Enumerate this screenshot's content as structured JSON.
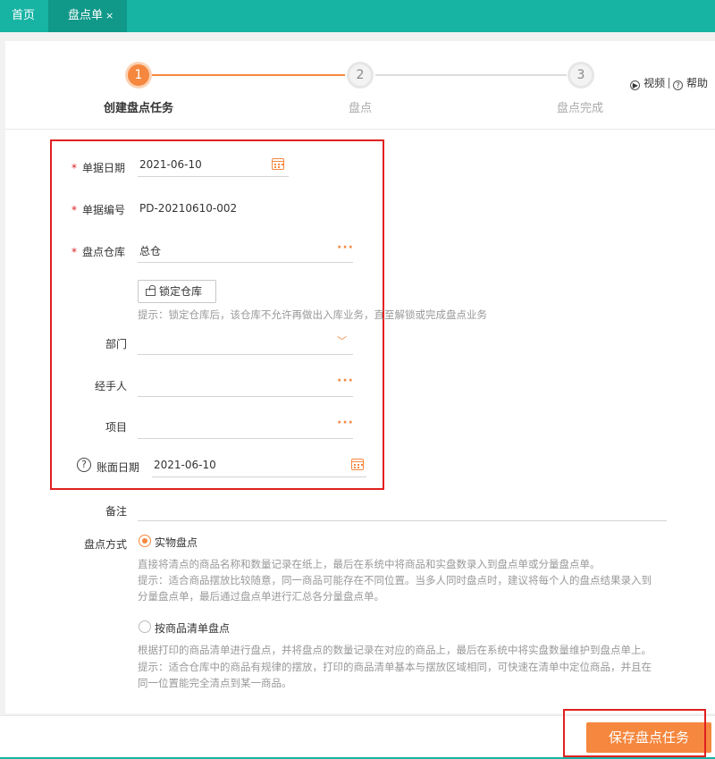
{
  "tabs": {
    "home": "首页",
    "active": "盘点单",
    "close": "×"
  },
  "steps": [
    {
      "number": "1",
      "label": "创建盘点任务"
    },
    {
      "number": "2",
      "label": "盘点"
    },
    {
      "number": "3",
      "label": "盘点完成"
    }
  ],
  "help": {
    "video": "视频",
    "help": "帮助"
  },
  "form": {
    "doc_date": {
      "label": "单据日期",
      "value": "2021-06-10"
    },
    "doc_no": {
      "label": "单据编号",
      "value": "PD-20210610-002"
    },
    "warehouse": {
      "label": "盘点仓库",
      "value": "总仓"
    },
    "lock_button": "锁定仓库",
    "lock_hint": "提示：锁定仓库后，该仓库不允许再做出入库业务，直至解锁或完成盘点业务",
    "department": {
      "label": "部门",
      "value": ""
    },
    "handler": {
      "label": "经手人",
      "value": ""
    },
    "project": {
      "label": "项目",
      "value": ""
    },
    "book_date": {
      "label": "账面日期",
      "value": "2021-06-10"
    },
    "remark": {
      "label": "备注",
      "value": ""
    },
    "method": {
      "label": "盘点方式",
      "options": [
        {
          "label": "实物盘点",
          "selected": true,
          "desc": "直接将清点的商品名称和数量记录在纸上，最后在系统中将商品和实盘数录入到盘点单或分量盘点单。",
          "tip1": "提示：适合商品摆放比较随意，同一商品可能存在不同位置。当多人同时盘点时，建议将每个人的盘点结果录入到",
          "tip2": "分量盘点单，最后通过盘点单进行汇总各分量盘点单。"
        },
        {
          "label": "按商品清单盘点",
          "selected": false,
          "desc": "根据打印的商品清单进行盘点，并将盘点的数量记录在对应的商品上，最后在系统中将实盘数量维护到盘点单上。",
          "tip1": "提示：适合仓库中的商品有规律的摆放，打印的商品清单基本与摆放区域相同，可快速在清单中定位商品，并且在",
          "tip2": "同一位置能完全清点到某一商品。"
        }
      ]
    }
  },
  "footer": {
    "save_label": "保存盘点任务"
  },
  "colors": {
    "accent": "#f5873e",
    "topbar": "#17b3a3",
    "highlight": "#e02020"
  }
}
